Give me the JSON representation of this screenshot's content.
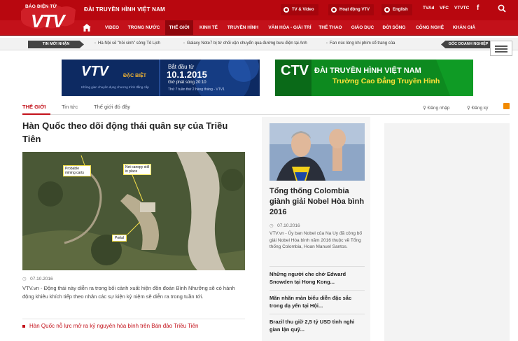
{
  "header": {
    "logo_small": "BÁO ĐIỆN TỬ",
    "logo_text": "VTV",
    "site_title": "ĐÀI TRUYỀN HÌNH VIỆT NAM",
    "links": [
      "TV & Video",
      "Hoạt động VTV",
      "English"
    ],
    "channels": [
      "TVAd",
      "VFC",
      "VTVTC"
    ],
    "facebook": "f"
  },
  "nav": {
    "items": [
      "VIDEO",
      "TRONG NƯỚC",
      "THẾ GIỚI",
      "KINH TẾ",
      "TRUYỀN HÌNH",
      "VĂN HÓA - GIẢI TRÍ",
      "THỂ THAO",
      "GIÁO DỤC",
      "ĐỜI SỐNG",
      "CÔNG NGHỆ",
      "KHÁN GIẢ"
    ],
    "active": "THẾ GIỚI"
  },
  "ticker": {
    "label": "TIN MỚI NHẬN",
    "items": [
      "Hà Nội sẽ \"hồi sinh\" sông Tô Lịch",
      "Galaxy Note7 bị từ chối vận chuyển qua đường bưu điện tại Anh",
      "Fan núc lòng khi phim cổ trang của"
    ],
    "right_label": "GÓC DOANH NGHIỆP"
  },
  "banner1": {
    "logo": "VTV",
    "logo_sub": "ĐẶC BIỆT",
    "small": "Không gian chuyên dụng chương trình đẳng cấp",
    "date_label": "Bắt đầu từ",
    "date": "10.1.2015",
    "time": "Giờ phát sóng 20:10",
    "schedule": "Thứ 7 tuần thứ 2 hàng tháng - VTV1"
  },
  "banner2": {
    "logo": "CTV",
    "line1": "ĐÀI TRUYỀN HÌNH VIỆT NAM",
    "line2": "Trường Cao Đẳng Truyền Hình"
  },
  "section": {
    "tabs": [
      "THẾ GIỚI",
      "Tin tức",
      "Thế giới đó đây"
    ],
    "login": "Đăng nhập",
    "register": "Đăng ký"
  },
  "main_article": {
    "title": "Hàn Quốc theo dõi động thái quân sự của Triều Tiên",
    "image_labels": [
      "Probable mining carts",
      "Net canopy still in place",
      "Portal"
    ],
    "date": "07.10.2016",
    "description": "VTV.vn - Động thái này diễn ra trong bối cảnh xuất hiện đồn đoán Bình Nhưỡng sẽ có hành động khiêu khích tiếp theo nhân các sự kiện kỷ niệm sẽ diễn ra trong tuần tới.",
    "related": "Hàn Quốc nỗ lực mở ra kỷ nguyên hòa bình trên Bán đảo Triều Tiên"
  },
  "side_article": {
    "title": "Tổng thống Colombia giành giải Nobel Hòa bình 2016",
    "date": "07.10.2016",
    "description": "VTV.vn - Ủy ban Nobel của Na Uy đã công bố giải Nobel Hòa bình năm 2016 thuộc về Tổng thống Colombia, Hoan Manuel Santos.",
    "list": [
      "Những người che chở Edward Snowden tại Hong Kong...",
      "Mãn nhãn màn biểu diễn đặc sắc trong dạ yến tại Hội...",
      "Brazil thu giữ 2,5 tỷ USD tình nghi gian lận quỹ..."
    ]
  },
  "colors": {
    "brand": "#c3111a",
    "header": "#b8070f"
  }
}
